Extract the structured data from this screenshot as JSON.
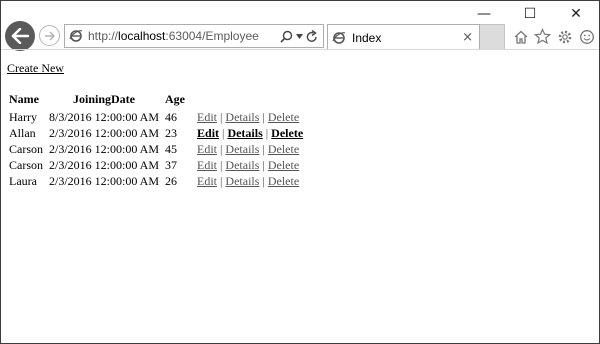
{
  "window": {
    "minimize_glyph": "—",
    "maximize_glyph": "☐",
    "close_glyph": "✕"
  },
  "browser": {
    "url_prefix": "http://",
    "url_host": "localhost",
    "url_rest": ":63004/Employee",
    "tab_title": "Index",
    "tab_close": "×"
  },
  "page": {
    "create_new": "Create New",
    "columns": [
      "Name",
      "JoiningDate",
      "Age"
    ],
    "rows": [
      {
        "name": "Harry",
        "joining": "8/3/2016 12:00:00 AM",
        "age": "46"
      },
      {
        "name": "Allan",
        "joining": "2/3/2016 12:00:00 AM",
        "age": "23"
      },
      {
        "name": "Carson",
        "joining": "2/3/2016 12:00:00 AM",
        "age": "45"
      },
      {
        "name": "Carson",
        "joining": "2/3/2016 12:00:00 AM",
        "age": "37"
      },
      {
        "name": "Laura",
        "joining": "2/3/2016 12:00:00 AM",
        "age": "26"
      }
    ],
    "actions": {
      "edit": "Edit",
      "details": "Details",
      "delete": "Delete",
      "sep": "|"
    }
  }
}
